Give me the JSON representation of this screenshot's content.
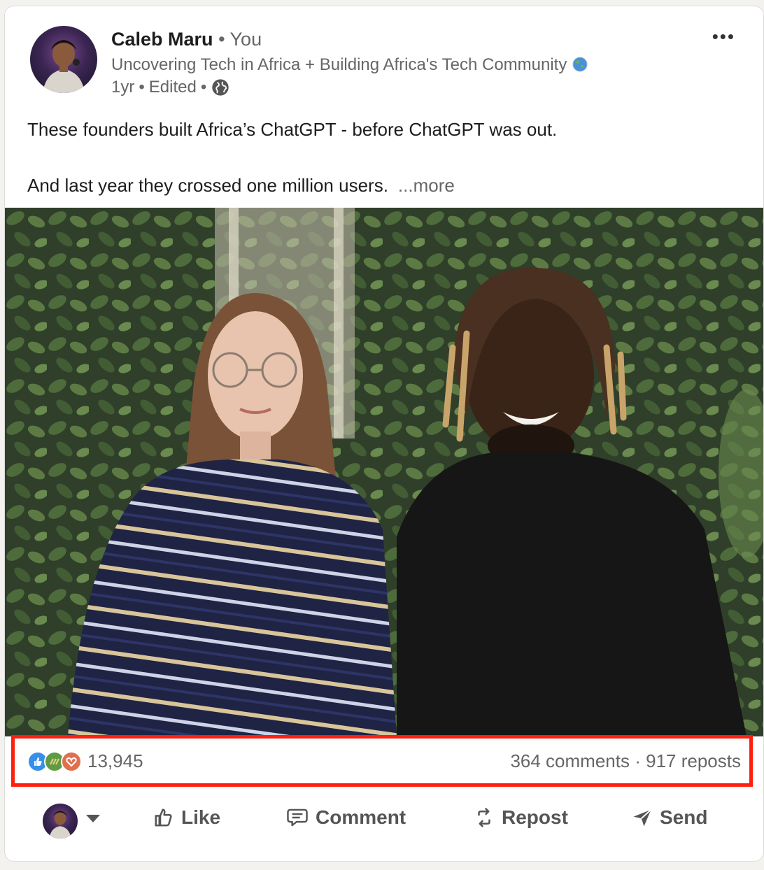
{
  "post": {
    "author_name": "Caleb Maru",
    "separator": "•",
    "relation": "You",
    "headline": "Uncovering Tech in Africa + Building Africa's Tech Community",
    "time": "1yr",
    "edited": "Edited",
    "meta_separator": "•",
    "more_menu": "•••",
    "text_line1": "These founders built Africa’s ChatGPT - before ChatGPT was out.",
    "text_line2": "And last year they crossed one million users.",
    "see_more": "...more"
  },
  "stats": {
    "reaction_count": "13,945",
    "comments": "364 comments",
    "dot": "·",
    "reposts": "917 reposts",
    "reaction_icons": [
      "like-icon",
      "support-icon",
      "love-icon"
    ]
  },
  "actions": {
    "like": "Like",
    "comment": "Comment",
    "repost": "Repost",
    "send": "Send"
  },
  "colors": {
    "highlight": "#ff1f0f",
    "like": "#378fe9",
    "support": "#5f9b41",
    "love": "#df704d"
  }
}
